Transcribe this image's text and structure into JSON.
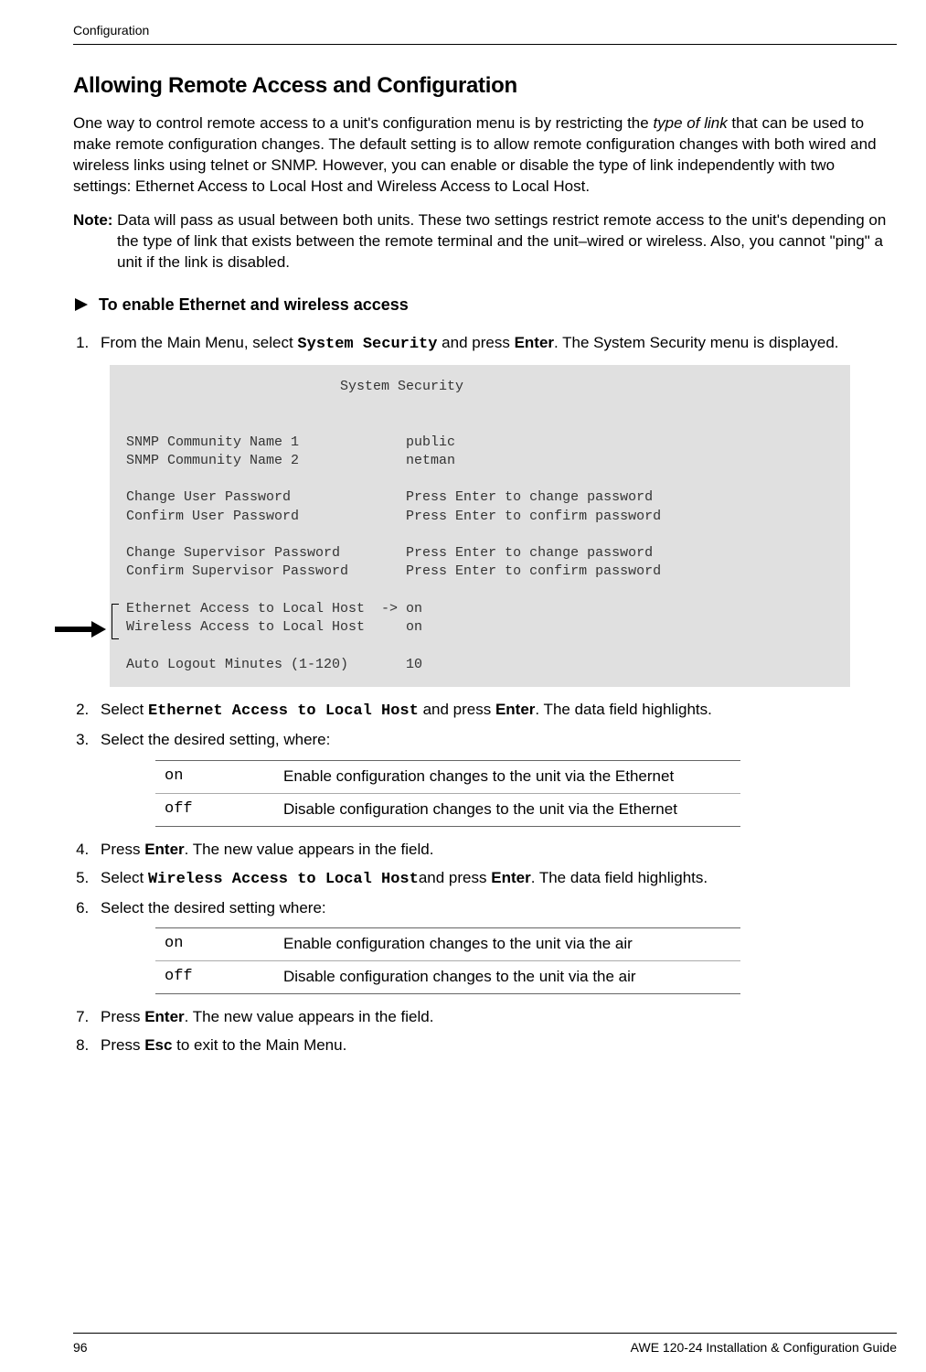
{
  "running_head": "Configuration",
  "section_title": "Allowing Remote Access and Configuration",
  "intro_p1_a": "One way to control remote access to a unit's configuration menu is by restricting the ",
  "intro_p1_italic": "type of link",
  "intro_p1_b": " that can be used to make remote configuration changes. The default setting is to allow remote configuration changes with both wired and wireless links using telnet or SNMP. However, you can enable or disable the type of link independently with two settings: Ethernet Access to Local Host and Wireless Access to Local Host.",
  "note_label": "Note:",
  "note_body": " Data will pass as usual between both units. These two settings restrict remote access to the unit's depending on the type of link that exists between the remote terminal and the unit–wired or wireless. Also, you cannot \"ping\" a unit if the link is disabled.",
  "to_enable": "To enable Ethernet and wireless access",
  "step1_a": "From the Main Menu, select ",
  "step1_code": "System Security",
  "step1_b": " and press ",
  "step1_enter": "Enter",
  "step1_c": ". The System Security menu is displayed.",
  "terminal": "                          System Security\n\n\nSNMP Community Name 1             public\nSNMP Community Name 2             netman\n\nChange User Password              Press Enter to change password\nConfirm User Password             Press Enter to confirm password\n\nChange Supervisor Password        Press Enter to change password\nConfirm Supervisor Password       Press Enter to confirm password\n\nEthernet Access to Local Host  -> on\nWireless Access to Local Host     on\n\nAuto Logout Minutes (1-120)       10",
  "step2_a": "Select ",
  "step2_code": "Ethernet Access to Local Host",
  "step2_b": " and press ",
  "step2_enter": "Enter",
  "step2_c": ". The data field highlights.",
  "step3": "Select the desired setting, where:",
  "tbl1": {
    "r1c1": "on",
    "r1c2": "Enable configuration changes to the unit via the Ethernet",
    "r2c1": "off",
    "r2c2": "Disable configuration changes to the unit via the Ethernet"
  },
  "step4_a": "Press ",
  "step4_enter": "Enter",
  "step4_b": ". The new value appears in the field.",
  "step5_a": "Select ",
  "step5_code": "Wireless Access to Local Host",
  "step5_b": "and press ",
  "step5_enter": "Enter",
  "step5_c": ". The data field highlights.",
  "step6": "Select the desired setting where:",
  "tbl2": {
    "r1c1": "on",
    "r1c2": "Enable configuration changes to the unit via the air",
    "r2c1": "off",
    "r2c2": "Disable configuration changes to the unit via the air"
  },
  "step7_a": "Press ",
  "step7_enter": "Enter",
  "step7_b": ". The new value appears in the field.",
  "step8_a": "Press ",
  "step8_esc": "Esc",
  "step8_b": " to exit to the Main Menu.",
  "page_number": "96",
  "footer_right": "AWE 120-24 Installation & Configuration Guide"
}
